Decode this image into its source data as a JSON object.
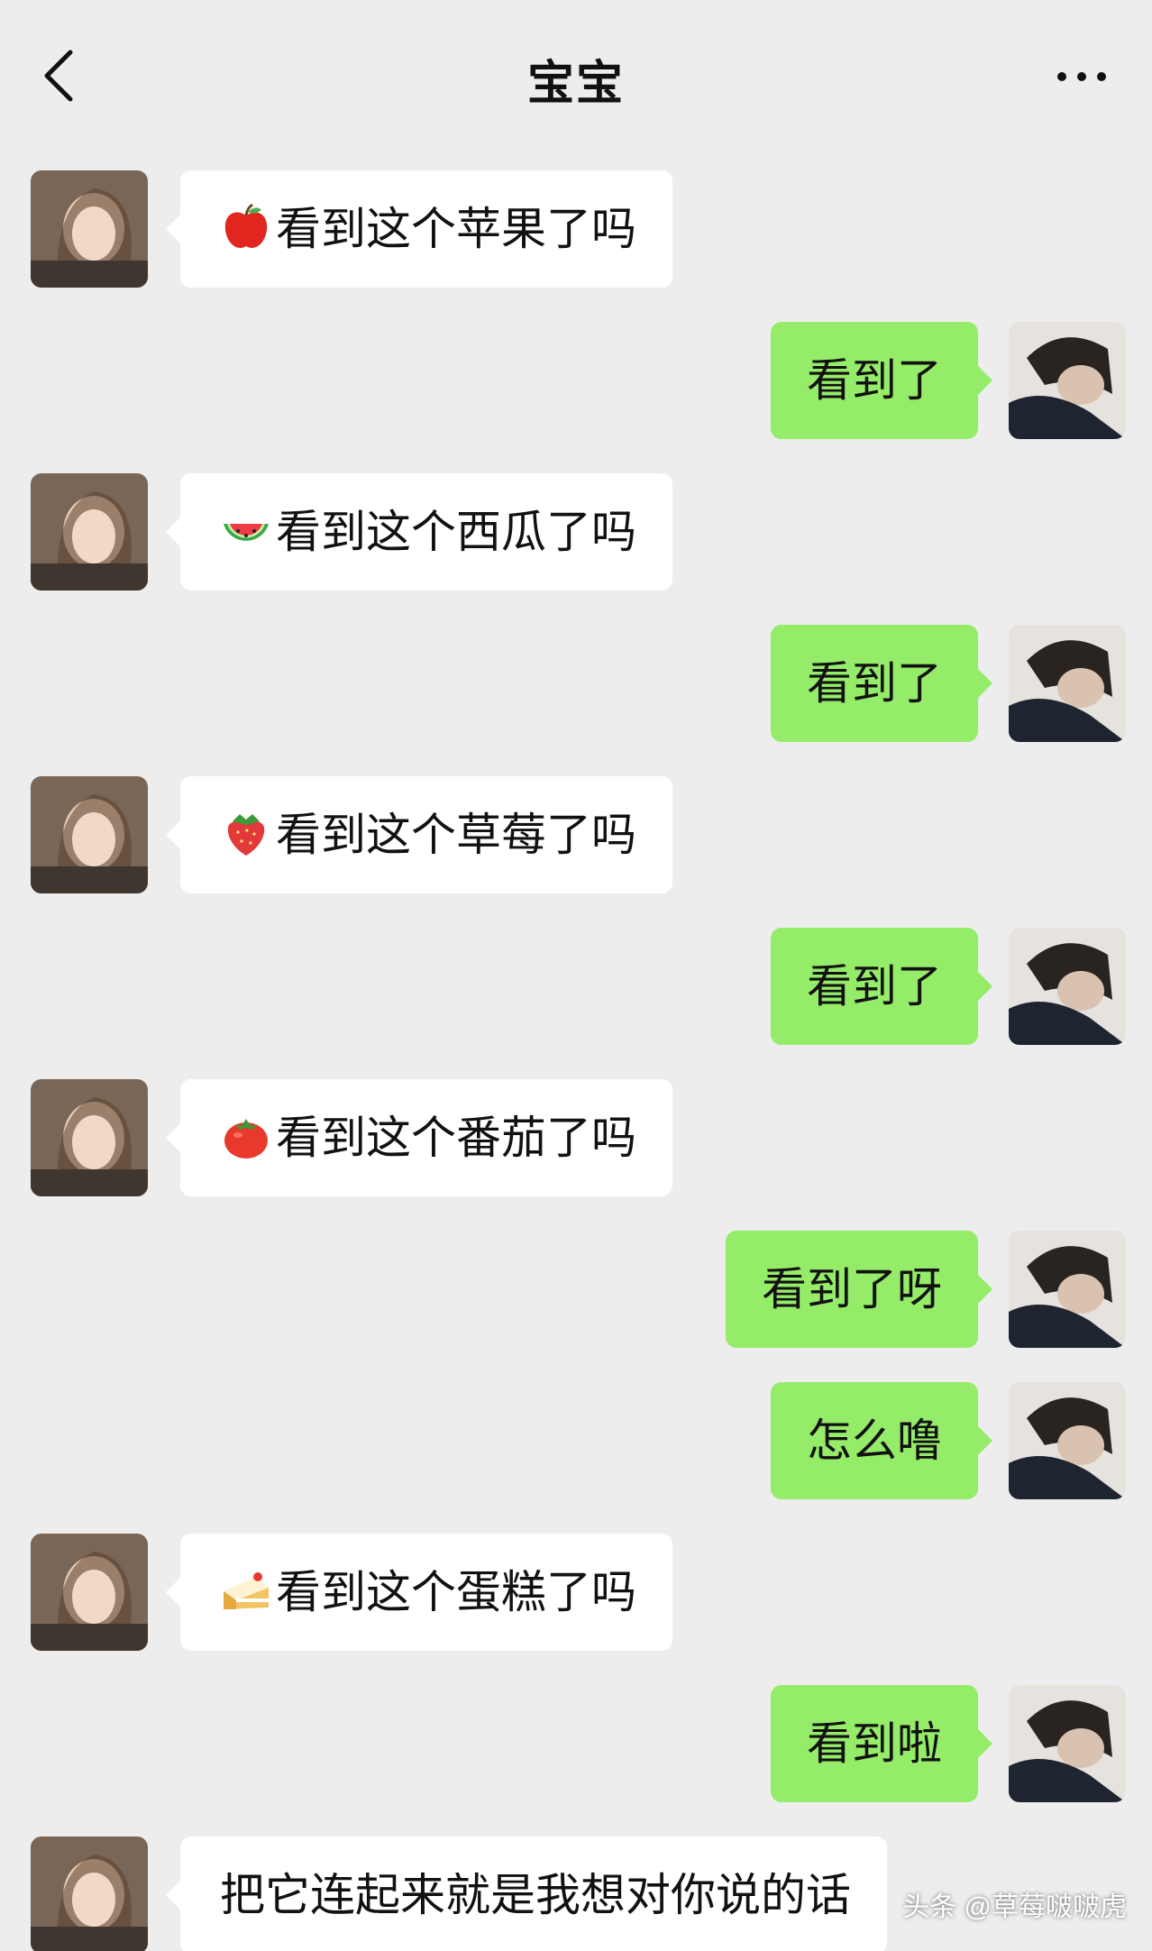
{
  "header": {
    "title": "宝宝",
    "back_icon": "chevron-left-icon",
    "more_icon": "ellipsis-icon"
  },
  "colors": {
    "background": "#ededed",
    "sent_bubble": "#95ec69",
    "received_bubble": "#ffffff"
  },
  "messages": [
    {
      "side": "received",
      "emoji": "apple-emoji",
      "text": "看到这个苹果了吗"
    },
    {
      "side": "sent",
      "text": "看到了"
    },
    {
      "side": "received",
      "emoji": "watermelon-emoji",
      "text": "看到这个西瓜了吗"
    },
    {
      "side": "sent",
      "text": "看到了"
    },
    {
      "side": "received",
      "emoji": "strawberry-emoji",
      "text": "看到这个草莓了吗"
    },
    {
      "side": "sent",
      "text": "看到了"
    },
    {
      "side": "received",
      "emoji": "tomato-emoji",
      "text": "看到这个番茄了吗"
    },
    {
      "side": "sent",
      "text": "看到了呀"
    },
    {
      "side": "sent",
      "text": "怎么噜"
    },
    {
      "side": "received",
      "emoji": "cake-emoji",
      "text": "看到这个蛋糕了吗"
    },
    {
      "side": "sent",
      "text": "看到啦"
    },
    {
      "side": "received",
      "text": "把它连起来就是我想对你说的话"
    }
  ],
  "watermark": "头条 @草莓啵啵虎"
}
